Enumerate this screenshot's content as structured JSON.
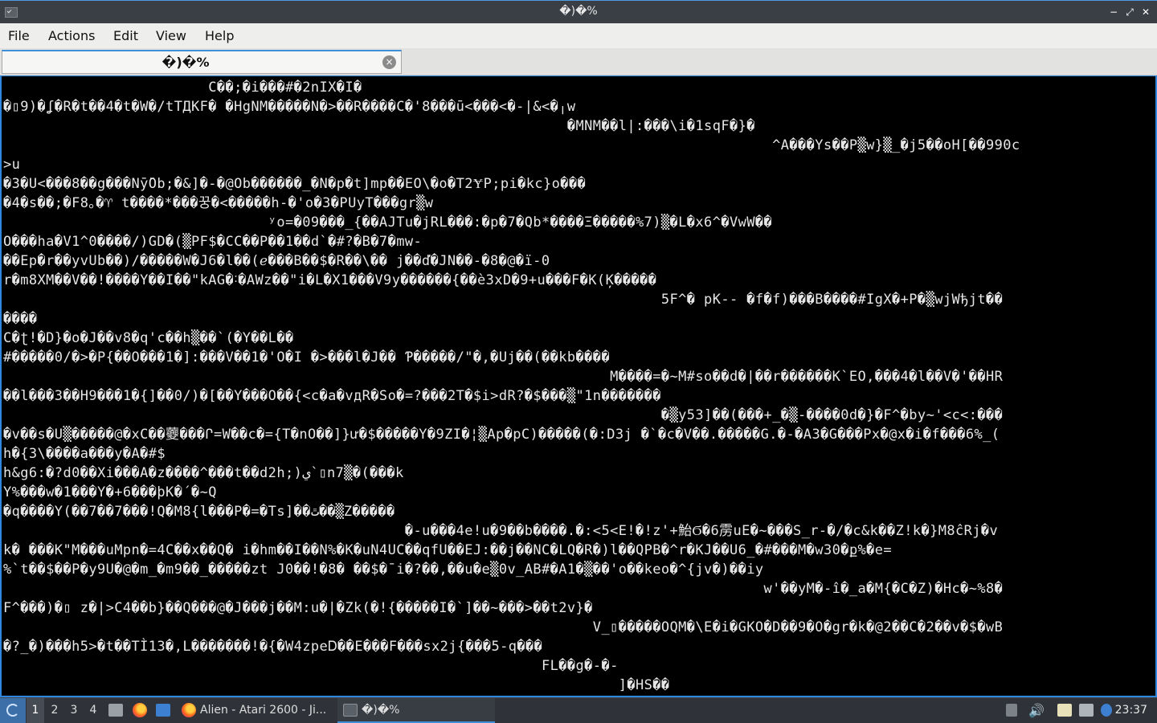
{
  "window": {
    "title": "�)�%",
    "controls": {
      "minimize": "−",
      "restore": "⤢",
      "close": "✕"
    }
  },
  "menubar": {
    "items": [
      "File",
      "Actions",
      "Edit",
      "View",
      "Help"
    ]
  },
  "tab": {
    "label": "�)�%",
    "close_glyph": "×"
  },
  "terminal": {
    "lines": [
      "                        C��;�i���#�2nIX�I�",
      "�▯9)�ʆ�R�t��4�t�W�/tTДKF� �HgNM�����N�>��R����C�'8���ū<���<�-|&<�╷w",
      "                                                                  �MNM��l|:���\\i�1sqF�}�",
      "                                                                                          ^A���Ys��P▒w}▒_�j5��oH[��990c",
      ">u",
      "�3�U<���8��g���Nȳ̄Ob;�&]�-�@Ob������_�N�p�t]mp��EO\\�o�T2Ɏ‍P;pi�kc}o���",
      "�4�s��;�F8｡�♈ t����*���꿍�<�����h-�'o�3�PUyT���gr▒w",
      "                               ʸo=�09���_{��AJTu�jRL���:�p�7�Qb*����Ξ�����%7)▒�L�x6^�VwW��",
      "O���ha�V1^0����/)GD�(▒PF$�CC��P��1��d`�#?�B�7�mw-",
      "��Ep�r��yvUb��)/�����W�J6�l��(ℯ���B��$�R��\\�� j��ď�JN��-�8�@�ï-0",
      "r�m8XM��V��!����Y��I��\"kAG�˸�AWz��\"i�L�X1���V9y������{��è3xD�9+u���F�K(Ķ�����",
      "                                                                             5F^� pK-- �f�f)���B����#IgX�+P�▒wjWђjt��",
      "����",
      "C�ʈ!�D}�o�J��v8�q'c��h▒��`(�Y��L��",
      "#�����0/�>�P{��O���1�]:���V��1�'O�I �>���l�J�� Ƥ�����/\"�,�Uj��(��kb����",
      "                                                                       M����=�~M#so��d�|��r������K`EO,���4�l��V�'��HR",
      "��l���3��H9���1�{]��0/)�[��Y���O��{<c�a�vдR�So�=?���2T�$i>dR?�$���▒\"1n�������",
      "                                                                             �▒y53]��(���+_�▒-����0d�}�F^�by~'<c<:���",
      "�v��s�U▒�����@�xC��蘷���Ր=W��c�={T�nO��]}ư�$�����Y�9ZI�¦▒Ap�pC)�����(�:D3j �`�c�V��.�����G.�-�A3�G���Px�@x�i�f���6%_(",
      "h�{3\\����a���y�A�#$",
      "h&g6:�?d0��Xi���A�z����^���t��d2h;)ي`▯n7▒�(���k",
      "Y%���w�1���Y�+6���ϸK�´�~Q",
      "�q����Y(��7��7���!Q�M8{l���P�=�Ts]��ٿ��▒Z�����",
      "                                               �-u���4e!u�9��b����.�:<5<E!�!z'+鮐Ϭ�6雳uE�~���S_r-�/�c&k��Z!k�}M8ĉRj�v",
      "k� ���K\"M���uMpn�=4C��x��Q� i�hm��I��N%�K�uN4UC��qfU��EJ:��j��NC�LQ�R�)l��QPB�^r�KJ��U6_�#���M�w30�ք%�e=",
      "%`t��$��P�y9U�@�m_�m9��_�����zt J0��!�8� ��$�¯i�?��,��u�e▒0v_AB#�A1�▒��'o��keo�^{jv�)��iy",
      "                                                                                         w'��yM�-î�_a�M{�C�Z)�Hc�~%8�",
      "F^���)�▯ z�|>C4��b}��Q���@�J���j��M:u�|�Zk(�!{�����I�`]��~���>��t2v}�",
      "                                                                     V_▯�����OQM�\\E�i�GKO�D��9�O�gr�k�@2��C�2��v�$�wB",
      "�?_�)���h5>�t��TÌ13�‚L�������!�{�W4zpeᎠ��E���F���sx2j{���5-q���",
      "                                                               FL��g�-�-",
      "                                                                        ]�HS��"
    ]
  },
  "taskbar": {
    "workspaces": [
      "1",
      "2",
      "3",
      "4"
    ],
    "tasks": [
      {
        "label": "Alien - Atari 2600 - Ji...",
        "icon": "firefox-icon"
      },
      {
        "label": "�)�%",
        "icon": "terminal-icon"
      }
    ],
    "clock": "23:37"
  }
}
